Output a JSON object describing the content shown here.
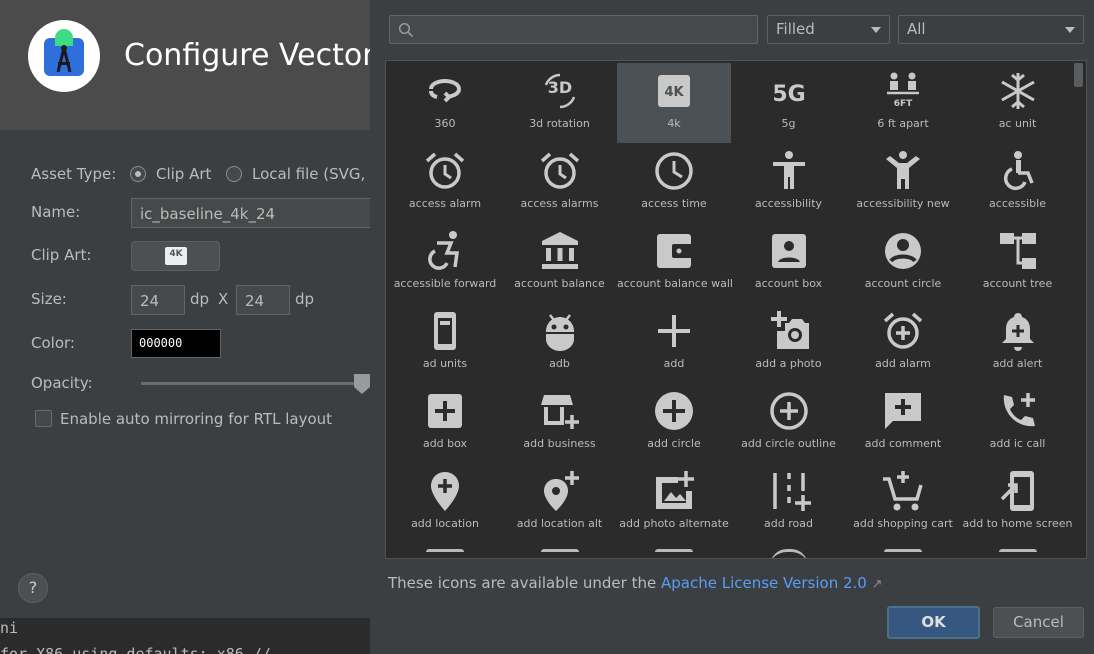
{
  "dialog": {
    "title": "Configure Vector",
    "asset_type_label": "Asset Type:",
    "asset_type_options": [
      "Clip Art",
      "Local file (SVG, P"
    ],
    "name_label": "Name:",
    "name_value": "ic_baseline_4k_24",
    "clipart_label": "Clip Art:",
    "clipart_icon_text": "4K",
    "size_label": "Size:",
    "width_value": "24",
    "height_value": "24",
    "unit_dp": "dp",
    "times": "X",
    "color_label": "Color:",
    "color_value": "000000",
    "opacity_label": "Opacity:",
    "opacity_value": 1.0,
    "mirror_label": "Enable auto mirroring for RTL layout",
    "help_label": "?",
    "terminal_lines": [
      "ni",
      "for X86 using defaults: x86 //"
    ]
  },
  "picker": {
    "search_placeholder": "",
    "style_select": "Filled",
    "category_select": "All",
    "selected_icon": "4k",
    "rows": [
      [
        {
          "label": "360",
          "icon": "360-icon"
        },
        {
          "label": "3d rotation",
          "icon": "3d-rotation-icon"
        },
        {
          "label": "4k",
          "icon": "4k-icon"
        },
        {
          "label": "5g",
          "icon": "5g-icon"
        },
        {
          "label": "6 ft apart",
          "icon": "6-ft-apart-icon"
        },
        {
          "label": "ac unit",
          "icon": "ac-unit-icon"
        }
      ],
      [
        {
          "label": "access alarm",
          "icon": "access-alarm-icon"
        },
        {
          "label": "access alarms",
          "icon": "access-alarms-icon"
        },
        {
          "label": "access time",
          "icon": "access-time-icon"
        },
        {
          "label": "accessibility",
          "icon": "accessibility-icon"
        },
        {
          "label": "accessibility new",
          "icon": "accessibility-new-icon"
        },
        {
          "label": "accessible",
          "icon": "accessible-icon"
        }
      ],
      [
        {
          "label": "accessible forward",
          "icon": "accessible-forward-icon"
        },
        {
          "label": "account balance",
          "icon": "account-balance-icon"
        },
        {
          "label": "account balance wall",
          "icon": "account-balance-wallet-icon"
        },
        {
          "label": "account box",
          "icon": "account-box-icon"
        },
        {
          "label": "account circle",
          "icon": "account-circle-icon"
        },
        {
          "label": "account tree",
          "icon": "account-tree-icon"
        }
      ],
      [
        {
          "label": "ad units",
          "icon": "ad-units-icon"
        },
        {
          "label": "adb",
          "icon": "adb-icon"
        },
        {
          "label": "add",
          "icon": "add-icon"
        },
        {
          "label": "add a photo",
          "icon": "add-a-photo-icon"
        },
        {
          "label": "add alarm",
          "icon": "add-alarm-icon"
        },
        {
          "label": "add alert",
          "icon": "add-alert-icon"
        }
      ],
      [
        {
          "label": "add box",
          "icon": "add-box-icon"
        },
        {
          "label": "add business",
          "icon": "add-business-icon"
        },
        {
          "label": "add circle",
          "icon": "add-circle-icon"
        },
        {
          "label": "add circle outline",
          "icon": "add-circle-outline-icon"
        },
        {
          "label": "add comment",
          "icon": "add-comment-icon"
        },
        {
          "label": "add ic call",
          "icon": "add-ic-call-icon"
        }
      ],
      [
        {
          "label": "add location",
          "icon": "add-location-icon"
        },
        {
          "label": "add location alt",
          "icon": "add-location-alt-icon"
        },
        {
          "label": "add photo alternate",
          "icon": "add-photo-alternate-icon"
        },
        {
          "label": "add road",
          "icon": "add-road-icon"
        },
        {
          "label": "add shopping cart",
          "icon": "add-shopping-cart-icon"
        },
        {
          "label": "add to home screen",
          "icon": "add-to-home-screen-icon"
        }
      ]
    ],
    "license_prefix": "These icons are available under the",
    "license_link": "Apache License Version 2.0",
    "license_arrow": "↗",
    "ok_label": "OK",
    "cancel_label": "Cancel"
  },
  "colors": {
    "accent": "#365880",
    "link": "#589df6",
    "icon": "#c9c9c9",
    "grid_bg": "#2b2b2b"
  }
}
